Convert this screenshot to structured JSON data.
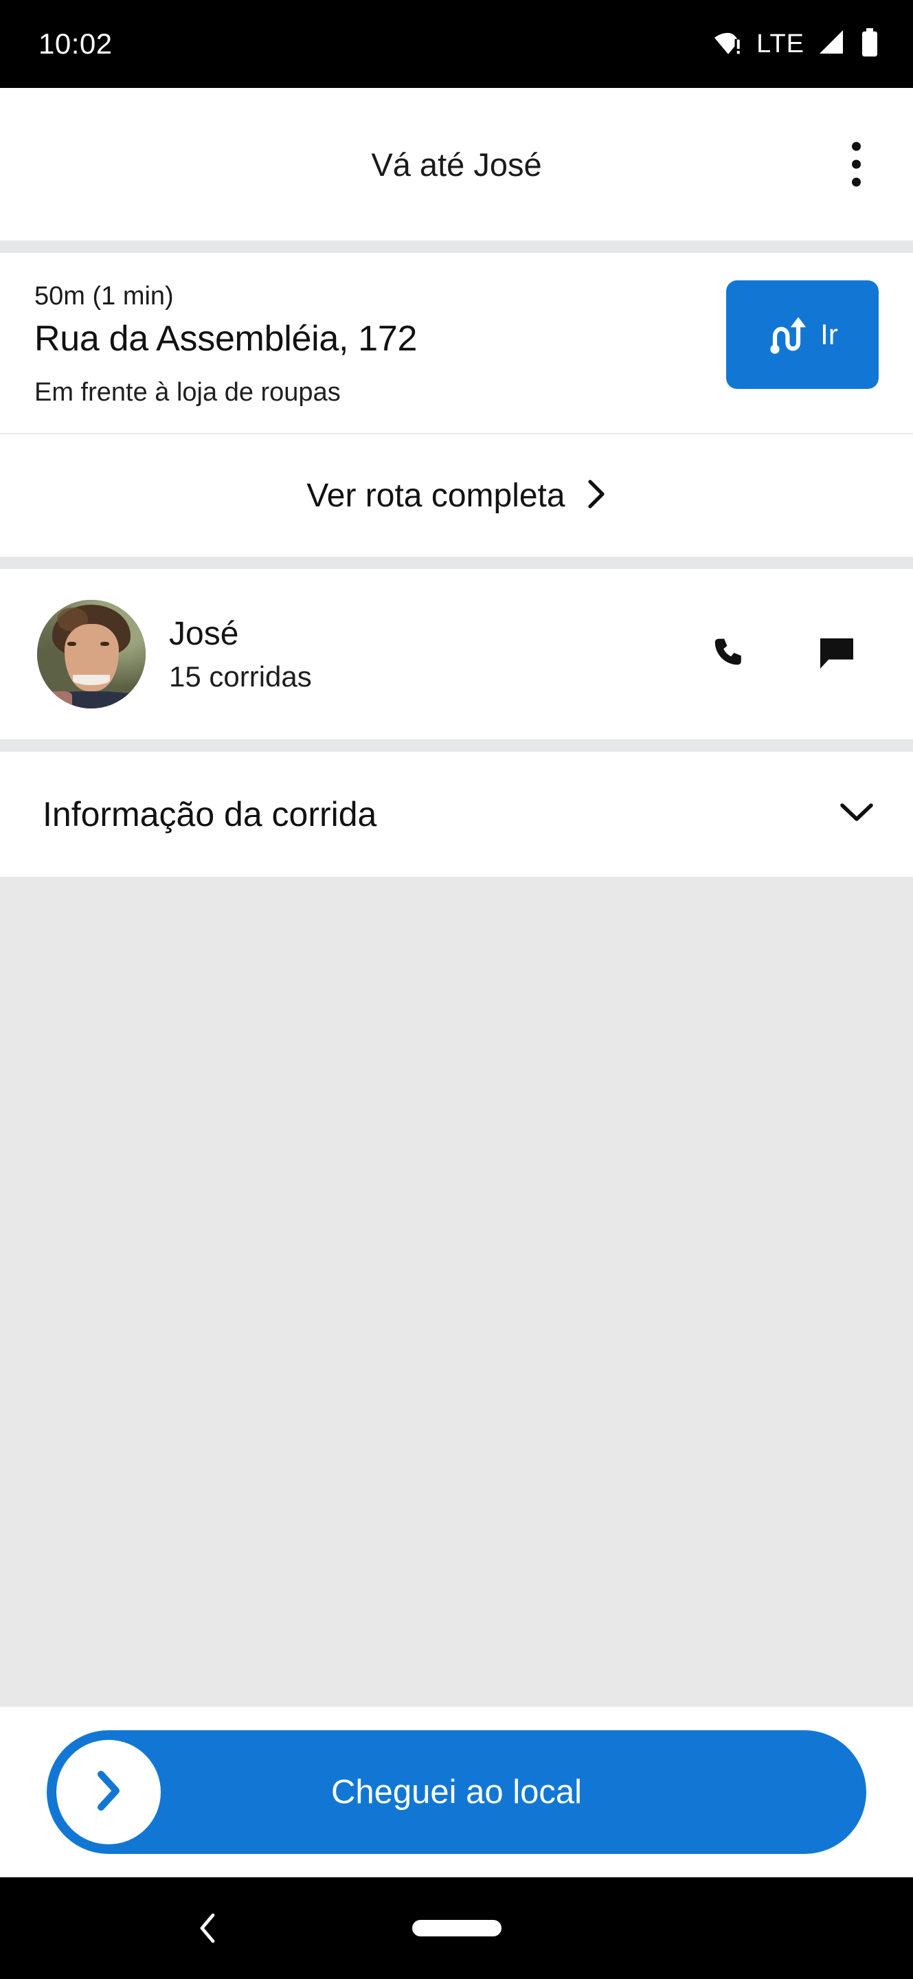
{
  "status_bar": {
    "time": "10:02",
    "network_label": "LTE",
    "wifi_icon": "wifi-warning-icon",
    "signal_icon": "cellular-signal-icon",
    "battery_icon": "battery-full-icon"
  },
  "header": {
    "title": "Vá até José",
    "overflow_icon": "more-vertical-icon"
  },
  "navigation_card": {
    "eta": "50m (1 min)",
    "address": "Rua da Assembléia, 172",
    "landmark_hint": "Em frente à loja de roupas",
    "go_button_label": "Ir",
    "go_button_icon": "route-navigate-icon",
    "go_button_color": "#1277d4"
  },
  "full_route": {
    "label": "Ver rota completa",
    "chevron_icon": "chevron-right-icon"
  },
  "rider": {
    "avatar_icon": "user-photo-avatar",
    "name": "José",
    "trips": "15 corridas",
    "call_icon": "phone-icon",
    "message_icon": "chat-bubble-icon"
  },
  "ride_info": {
    "label": "Informação da corrida",
    "expand_icon": "chevron-down-icon"
  },
  "map": {
    "placeholder_color": "#e8e8e8"
  },
  "cta": {
    "label": "Cheguei ao local",
    "knob_icon": "chevron-right-icon",
    "color": "#1277d4"
  },
  "system_nav": {
    "back_icon": "chevron-left-icon",
    "home_icon": "home-pill-icon"
  },
  "theme": {
    "accent": "#1277d4",
    "separator": "#e6e7e8",
    "map_gray": "#e8e8e8"
  }
}
